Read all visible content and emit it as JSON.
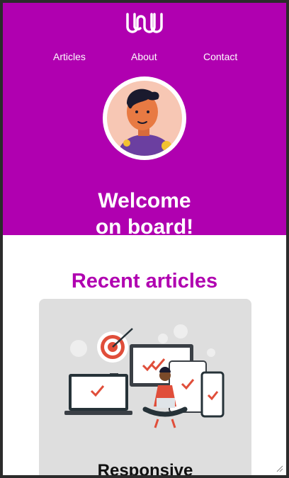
{
  "nav": {
    "items": [
      {
        "label": "Articles"
      },
      {
        "label": "About"
      },
      {
        "label": "Contact"
      }
    ]
  },
  "hero": {
    "headline_line1": "Welcome",
    "headline_line2": "on board!"
  },
  "recent": {
    "title": "Recent articles"
  },
  "articles": [
    {
      "title": "Responsive"
    }
  ],
  "colors": {
    "brand": "#b000b0",
    "accent": "#e04e3a",
    "card_bg": "#dedede"
  },
  "icons": {
    "logo": "uu-logo-icon",
    "target": "target-icon",
    "check": "check-icon"
  }
}
